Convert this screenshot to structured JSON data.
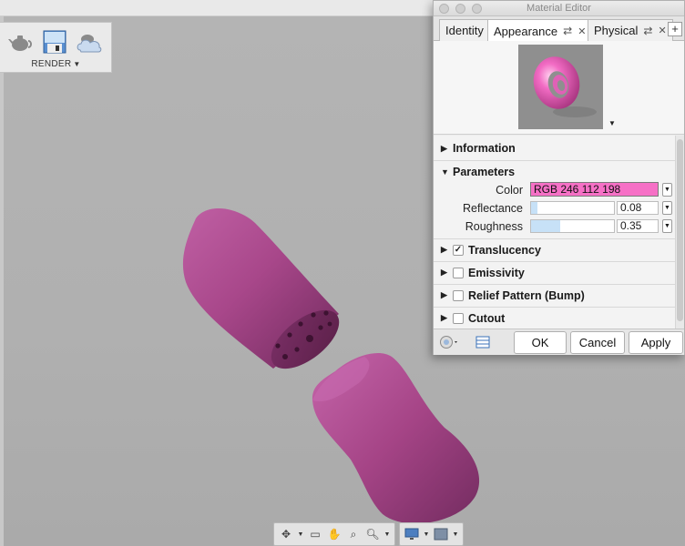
{
  "window": {
    "title": "Material Editor"
  },
  "render_toolbar": {
    "label": "RENDER"
  },
  "tabs": [
    {
      "label": "Identity"
    },
    {
      "label": "Appearance"
    },
    {
      "label": "Physical"
    }
  ],
  "sections": {
    "information": "Information",
    "parameters": "Parameters",
    "translucency": "Translucency",
    "emissivity": "Emissivity",
    "relief": "Relief Pattern (Bump)",
    "cutout": "Cutout"
  },
  "parameters": {
    "color_label": "Color",
    "color_value": "RGB 246 112 198",
    "color_hex": "#f670c6",
    "reflectance_label": "Reflectance",
    "reflectance_value": "0.08",
    "reflectance_fraction": 0.08,
    "roughness_label": "Roughness",
    "roughness_value": "0.35",
    "roughness_fraction": 0.35
  },
  "checks": {
    "translucency": true,
    "emissivity": false,
    "relief": false,
    "cutout": false
  },
  "buttons": {
    "ok": "OK",
    "cancel": "Cancel",
    "apply": "Apply"
  },
  "icons": {
    "render_tools": [
      "teapot-icon",
      "save-render-icon",
      "cloud-render-icon"
    ],
    "nav": [
      "orbit-icon",
      "look-at-icon",
      "pan-icon",
      "zoom-window-icon",
      "zoom-icon",
      "display-settings-icon",
      "grid-settings-icon"
    ]
  },
  "colors": {
    "model_pink": "#b84e95",
    "viewport": "#b0b0b0"
  }
}
